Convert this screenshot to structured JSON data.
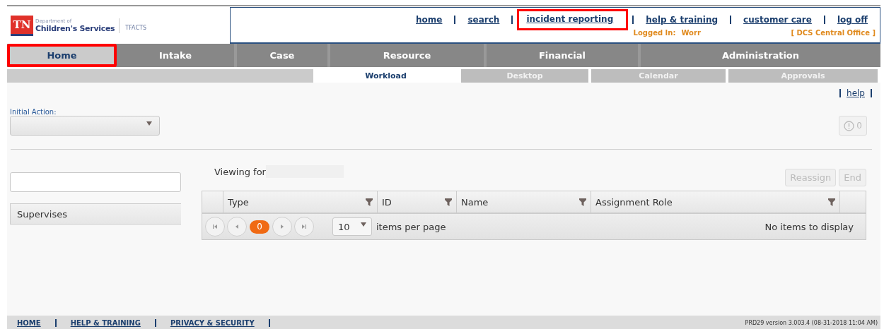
{
  "header": {
    "logo": {
      "badge": "TN",
      "line_1": "Department of",
      "line_2": "Children's Services",
      "app": "TFACTS"
    },
    "links": [
      {
        "label": "home",
        "highlighted": false
      },
      {
        "label": "search",
        "highlighted": false
      },
      {
        "label": "incident reporting",
        "highlighted": true
      },
      {
        "label": "help & training",
        "highlighted": false
      },
      {
        "label": "customer care",
        "highlighted": false
      },
      {
        "label": "log off",
        "highlighted": false
      }
    ],
    "logged_in_label": "Logged In:",
    "logged_in_user": "Worr",
    "office": "[ DCS Central Office ]"
  },
  "main_nav": [
    {
      "label": "Home",
      "selected": true,
      "highlighted": true
    },
    {
      "label": "Intake",
      "selected": false,
      "highlighted": false
    },
    {
      "label": "Case",
      "selected": false,
      "highlighted": false
    },
    {
      "label": "Resource",
      "selected": false,
      "highlighted": false
    },
    {
      "label": "Financial",
      "selected": false,
      "highlighted": false
    },
    {
      "label": "Administration",
      "selected": false,
      "highlighted": false
    }
  ],
  "sub_tabs": [
    {
      "label": "Workload",
      "selected": true
    },
    {
      "label": "Desktop",
      "selected": false
    },
    {
      "label": "Calendar",
      "selected": false
    },
    {
      "label": "Approvals",
      "selected": false
    }
  ],
  "help_link": "help",
  "initial_action": {
    "label": "Initial Action:"
  },
  "alert_button": {
    "count": "0"
  },
  "viewing_for": "Viewing for",
  "buttons": [
    {
      "label": "Reassign",
      "disabled": true
    },
    {
      "label": "End",
      "disabled": true
    }
  ],
  "supervises": "Supervises",
  "table": {
    "columns": [
      "Type",
      "ID",
      "Name",
      "Assignment Role"
    ],
    "pager": {
      "current": "0",
      "page_size": "10",
      "per_page_label": "items per page",
      "empty_text": "No items to display"
    }
  },
  "footer": {
    "links": [
      "HOME",
      "HELP & TRAINING",
      "PRIVACY & SECURITY"
    ],
    "version": "PRD29 version  3.003.4 (08-31-2018 11:04 AM)"
  }
}
